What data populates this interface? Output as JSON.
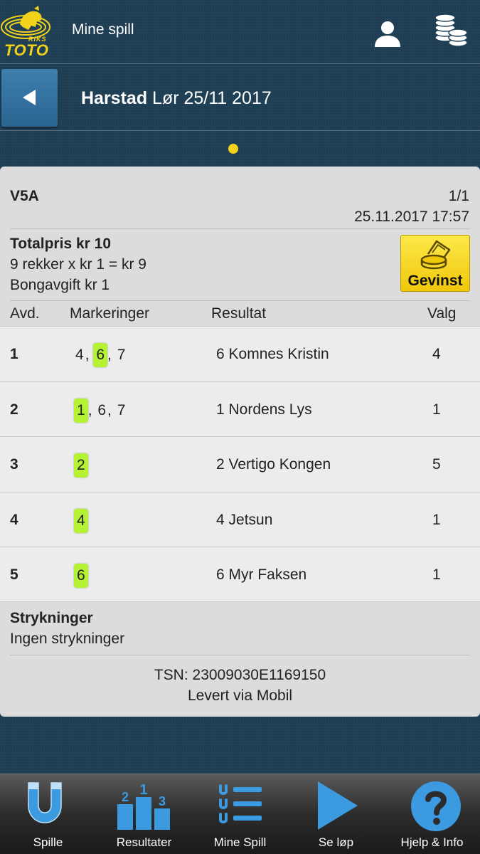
{
  "header": {
    "logo_small": "RIKS",
    "logo_text": "TOTO",
    "title": "Mine spill",
    "icons": [
      "user-icon",
      "coins-icon"
    ]
  },
  "race": {
    "track": "Harstad",
    "date": "Lør 25/11 2017"
  },
  "coupon": {
    "game_type": "V5A",
    "page": "1/1",
    "datetime": "25.11.2017 17:57",
    "total_price": "Totalpris kr 10",
    "rows_calc": "9 rekker x kr 1 = kr 9",
    "fee": "Bongavgift kr 1",
    "gevinst_label": "Gevinst",
    "columns": {
      "avd": "Avd.",
      "markeringer": "Markeringer",
      "resultat": "Resultat",
      "valg": "Valg"
    },
    "legs": [
      {
        "avd": "1",
        "marks": [
          "4",
          "6",
          "7"
        ],
        "hit": "6",
        "result": "6 Komnes Kristin",
        "valg": "4"
      },
      {
        "avd": "2",
        "marks": [
          "1",
          "6",
          "7"
        ],
        "hit": "1",
        "result": "1 Nordens Lys",
        "valg": "1"
      },
      {
        "avd": "3",
        "marks": [
          "2"
        ],
        "hit": "2",
        "result": "2 Vertigo Kongen",
        "valg": "5"
      },
      {
        "avd": "4",
        "marks": [
          "4"
        ],
        "hit": "4",
        "result": "4 Jetsun",
        "valg": "1"
      },
      {
        "avd": "5",
        "marks": [
          "6"
        ],
        "hit": "6",
        "result": "6 Myr Faksen",
        "valg": "1"
      }
    ],
    "strikes_title": "Strykninger",
    "strikes_text": "Ingen strykninger",
    "tsn": "TSN: 23009030E1169150",
    "delivered": "Levert via Mobil"
  },
  "nav": [
    {
      "label": "Spille",
      "icon": "magnet-icon"
    },
    {
      "label": "Resultater",
      "icon": "podium-icon"
    },
    {
      "label": "Mine Spill",
      "icon": "list-icon"
    },
    {
      "label": "Se løp",
      "icon": "play-icon"
    },
    {
      "label": "Hjelp & Info",
      "icon": "help-icon"
    }
  ],
  "colors": {
    "background": "#1f3f55",
    "accent_yellow": "#f2d21a",
    "hit_green": "#b5f233",
    "back_button": "#3d7fae",
    "nav_icon_blue": "#3b9ae0"
  }
}
